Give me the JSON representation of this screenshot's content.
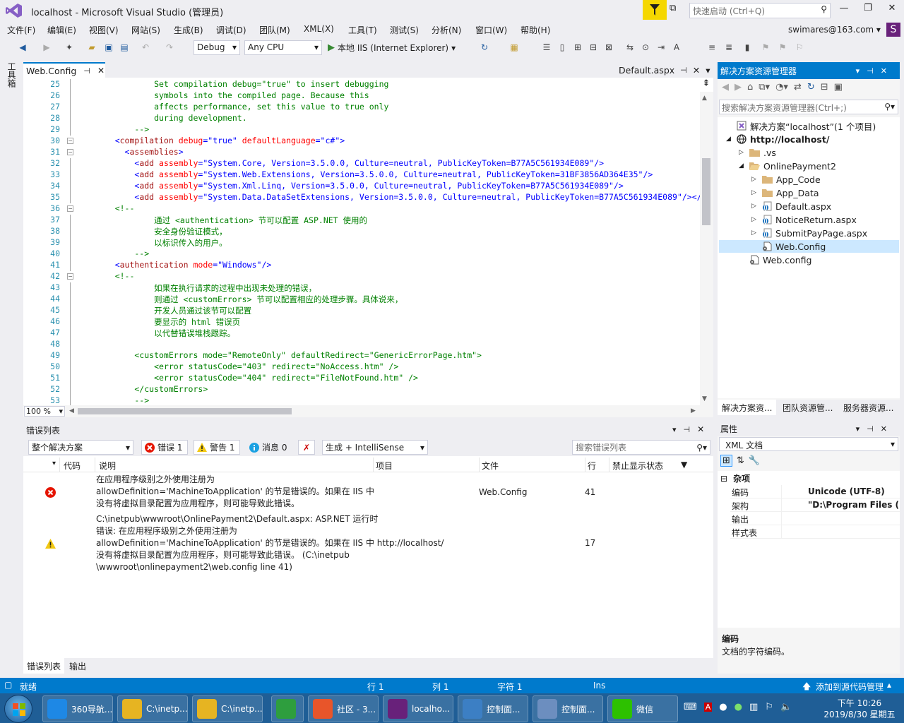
{
  "window": {
    "title": "localhost - Microsoft Visual Studio (管理员)",
    "quick_launch_placeholder": "快速启动 (Ctrl+Q)"
  },
  "menu": [
    "文件(F)",
    "编辑(E)",
    "视图(V)",
    "网站(S)",
    "生成(B)",
    "调试(D)",
    "团队(M)",
    "XML(X)",
    "工具(T)",
    "测试(S)",
    "分析(N)",
    "窗口(W)",
    "帮助(H)"
  ],
  "account": {
    "email": "swimares@163.com",
    "avatar_letter": "S"
  },
  "toolbar": {
    "config": "Debug",
    "platform": "Any CPU",
    "run_label": "本地 IIS (Internet Explorer)"
  },
  "toolbox": {
    "label": "工具箱"
  },
  "editor": {
    "active_tab": "Web.Config",
    "right_tab": "Default.aspx",
    "zoom": "100 %",
    "lines": [
      {
        "n": "25",
        "s": [
          {
            "c": "c",
            "t": "            Set compilation debug=\"true\" to insert debugging"
          }
        ]
      },
      {
        "n": "26",
        "s": [
          {
            "c": "c",
            "t": "            symbols into the compiled page. Because this"
          }
        ]
      },
      {
        "n": "27",
        "s": [
          {
            "c": "c",
            "t": "            affects performance, set this value to true only"
          }
        ]
      },
      {
        "n": "28",
        "s": [
          {
            "c": "c",
            "t": "            during development."
          }
        ]
      },
      {
        "n": "29",
        "s": [
          {
            "c": "c",
            "t": "        -->"
          }
        ]
      },
      {
        "n": "30",
        "fold": true,
        "s": [
          {
            "c": "b",
            "t": "    <"
          },
          {
            "c": "t",
            "t": "compilation"
          },
          {
            "c": "a",
            "t": " debug"
          },
          {
            "c": "b",
            "t": "=\""
          },
          {
            "c": "v",
            "t": "true"
          },
          {
            "c": "b",
            "t": "\""
          },
          {
            "c": "a",
            "t": " defaultLanguage"
          },
          {
            "c": "b",
            "t": "=\""
          },
          {
            "c": "v",
            "t": "c#"
          },
          {
            "c": "b",
            "t": "\">"
          }
        ]
      },
      {
        "n": "31",
        "fold": true,
        "s": [
          {
            "c": "b",
            "t": "      <"
          },
          {
            "c": "t",
            "t": "assemblies"
          },
          {
            "c": "b",
            "t": ">"
          }
        ]
      },
      {
        "n": "32",
        "s": [
          {
            "c": "b",
            "t": "        <"
          },
          {
            "c": "t",
            "t": "add"
          },
          {
            "c": "a",
            "t": " assembly"
          },
          {
            "c": "b",
            "t": "=\""
          },
          {
            "c": "v",
            "t": "System.Core, Version=3.5.0.0, Culture=neutral, PublicKeyToken=B77A5C561934E089"
          },
          {
            "c": "b",
            "t": "\"/>"
          }
        ]
      },
      {
        "n": "33",
        "s": [
          {
            "c": "b",
            "t": "        <"
          },
          {
            "c": "t",
            "t": "add"
          },
          {
            "c": "a",
            "t": " assembly"
          },
          {
            "c": "b",
            "t": "=\""
          },
          {
            "c": "v",
            "t": "System.Web.Extensions, Version=3.5.0.0, Culture=neutral, PublicKeyToken=31BF3856AD364E35"
          },
          {
            "c": "b",
            "t": "\"/>"
          }
        ]
      },
      {
        "n": "34",
        "s": [
          {
            "c": "b",
            "t": "        <"
          },
          {
            "c": "t",
            "t": "add"
          },
          {
            "c": "a",
            "t": " assembly"
          },
          {
            "c": "b",
            "t": "=\""
          },
          {
            "c": "v",
            "t": "System.Xml.Linq, Version=3.5.0.0, Culture=neutral, PublicKeyToken=B77A5C561934E089"
          },
          {
            "c": "b",
            "t": "\"/>"
          }
        ]
      },
      {
        "n": "35",
        "s": [
          {
            "c": "b",
            "t": "        <"
          },
          {
            "c": "t",
            "t": "add"
          },
          {
            "c": "a",
            "t": " assembly"
          },
          {
            "c": "b",
            "t": "=\""
          },
          {
            "c": "v",
            "t": "System.Data.DataSetExtensions, Version=3.5.0.0, Culture=neutral, PublicKeyToken=B77A5C561934E089"
          },
          {
            "c": "b",
            "t": "\"/></"
          },
          {
            "c": "t",
            "t": "as"
          }
        ]
      },
      {
        "n": "36",
        "fold": true,
        "s": [
          {
            "c": "c",
            "t": "    <!--"
          }
        ]
      },
      {
        "n": "37",
        "s": [
          {
            "c": "c",
            "t": "            通过 <authentication> 节可以配置 ASP.NET 使用的"
          }
        ]
      },
      {
        "n": "38",
        "s": [
          {
            "c": "c",
            "t": "            安全身份验证模式，"
          }
        ]
      },
      {
        "n": "39",
        "s": [
          {
            "c": "c",
            "t": "            以标识传入的用户。"
          }
        ]
      },
      {
        "n": "40",
        "s": [
          {
            "c": "c",
            "t": "        -->"
          }
        ]
      },
      {
        "n": "41",
        "s": [
          {
            "c": "b",
            "t": "    <"
          },
          {
            "c": "t",
            "t": "authentication"
          },
          {
            "c": "a",
            "t": " mode"
          },
          {
            "c": "b",
            "t": "=\""
          },
          {
            "c": "v",
            "t": "Windows"
          },
          {
            "c": "b",
            "t": "\"/>"
          }
        ]
      },
      {
        "n": "42",
        "fold": true,
        "s": [
          {
            "c": "c",
            "t": "    <!--"
          }
        ]
      },
      {
        "n": "43",
        "s": [
          {
            "c": "c",
            "t": "            如果在执行请求的过程中出现未处理的错误，"
          }
        ]
      },
      {
        "n": "44",
        "s": [
          {
            "c": "c",
            "t": "            则通过 <customErrors> 节可以配置相应的处理步骤。具体说来，"
          }
        ]
      },
      {
        "n": "45",
        "s": [
          {
            "c": "c",
            "t": "            开发人员通过该节可以配置"
          }
        ]
      },
      {
        "n": "46",
        "s": [
          {
            "c": "c",
            "t": "            要显示的 html 错误页"
          }
        ]
      },
      {
        "n": "47",
        "s": [
          {
            "c": "c",
            "t": "            以代替错误堆栈跟踪。"
          }
        ]
      },
      {
        "n": "48",
        "s": [
          {
            "c": "c",
            "t": ""
          }
        ]
      },
      {
        "n": "49",
        "s": [
          {
            "c": "c",
            "t": "        <customErrors mode=\"RemoteOnly\" defaultRedirect=\"GenericErrorPage.htm\">"
          }
        ]
      },
      {
        "n": "50",
        "s": [
          {
            "c": "c",
            "t": "            <error statusCode=\"403\" redirect=\"NoAccess.htm\" />"
          }
        ]
      },
      {
        "n": "51",
        "s": [
          {
            "c": "c",
            "t": "            <error statusCode=\"404\" redirect=\"FileNotFound.htm\" />"
          }
        ]
      },
      {
        "n": "52",
        "s": [
          {
            "c": "c",
            "t": "        </customErrors>"
          }
        ]
      },
      {
        "n": "53",
        "s": [
          {
            "c": "c",
            "t": "        -->"
          }
        ]
      }
    ]
  },
  "error_list": {
    "title": "错误列表",
    "scope": "整个解决方案",
    "errors_label": "错误 1",
    "warnings_label": "警告 1",
    "messages_label": "消息 0",
    "build_filter": "生成 + IntelliSense",
    "search_placeholder": "搜索错误列表",
    "columns": {
      "code": "代码",
      "desc": "说明",
      "project": "项目",
      "file": "文件",
      "line": "行",
      "suppress": "禁止显示状态"
    },
    "rows": [
      {
        "type": "error",
        "desc": [
          "在应用程序级别之外使用注册为",
          "allowDefinition='MachineToApplication' 的节是错误的。如果在 IIS 中",
          "没有将虚拟目录配置为应用程序，则可能导致此错误。"
        ],
        "project": "",
        "file": "Web.Config",
        "line": "41"
      },
      {
        "type": "warning",
        "desc": [
          "C:\\inetpub\\wwwroot\\OnlinePayment2\\Default.aspx: ASP.NET 运行时",
          "错误: 在应用程序级别之外使用注册为",
          "allowDefinition='MachineToApplication' 的节是错误的。如果在 IIS 中 http://localhost/",
          "没有将虚拟目录配置为应用程序，则可能导致此错误。 (C:\\inetpub",
          "\\wwwroot\\onlinepayment2\\web.config line 41)"
        ],
        "project": "",
        "file": "",
        "line": "17"
      }
    ],
    "bottom_tabs": [
      "错误列表",
      "输出"
    ]
  },
  "solution_explorer": {
    "title": "解决方案资源管理器",
    "search_placeholder": "搜索解决方案资源管理器(Ctrl+;)",
    "tree": [
      {
        "label": "解决方案“localhost”(1 个项目)",
        "depth": 0,
        "icon": "solution",
        "arrow": ""
      },
      {
        "label": "http://localhost/",
        "depth": 0,
        "icon": "globe",
        "arrow": "◢",
        "bold": true
      },
      {
        "label": ".vs",
        "depth": 1,
        "icon": "folder",
        "arrow": "▷"
      },
      {
        "label": "OnlinePayment2",
        "depth": 1,
        "icon": "folder-open",
        "arrow": "◢"
      },
      {
        "label": "App_Code",
        "depth": 2,
        "icon": "folder",
        "arrow": "▷"
      },
      {
        "label": "App_Data",
        "depth": 2,
        "icon": "folder",
        "arrow": "▷"
      },
      {
        "label": "Default.aspx",
        "depth": 2,
        "icon": "aspx",
        "arrow": "▷"
      },
      {
        "label": "NoticeReturn.aspx",
        "depth": 2,
        "icon": "aspx",
        "arrow": "▷"
      },
      {
        "label": "SubmitPayPage.aspx",
        "depth": 2,
        "icon": "aspx",
        "arrow": "▷"
      },
      {
        "label": "Web.Config",
        "depth": 2,
        "icon": "config",
        "arrow": "",
        "selected": true
      },
      {
        "label": "Web.config",
        "depth": 1,
        "icon": "config",
        "arrow": ""
      }
    ],
    "tabs": [
      "解决方案资...",
      "团队资源管...",
      "服务器资源..."
    ]
  },
  "properties": {
    "title": "属性",
    "object": "XML 文档",
    "category": "杂项",
    "rows": [
      {
        "name": "编码",
        "value": "Unicode (UTF-8)"
      },
      {
        "name": "架构",
        "value": "\"D:\\Program Files (x"
      },
      {
        "name": "输出",
        "value": ""
      },
      {
        "name": "样式表",
        "value": ""
      }
    ],
    "desc_title": "编码",
    "desc_text": "文档的字符编码。"
  },
  "status": {
    "ready": "就绪",
    "row": "行 1",
    "col": "列 1",
    "char": "字符 1",
    "mode": "Ins",
    "source": "添加到源代码管理"
  },
  "taskbar": {
    "items": [
      {
        "label": "360导航...",
        "color": "#1E88E5"
      },
      {
        "label": "C:\\inetp...",
        "color": "#E6B422"
      },
      {
        "label": "C:\\inetp...",
        "color": "#E6B422"
      },
      {
        "label": "",
        "color": "#2E9E3E"
      },
      {
        "label": "社区 - 3...",
        "color": "#E8552A"
      },
      {
        "label": "localho...",
        "color": "#68217A"
      },
      {
        "label": "控制面...",
        "color": "#3C7FC4"
      },
      {
        "label": "控制面...",
        "color": "#6C8EBF"
      },
      {
        "label": "微信",
        "color": "#2DC100"
      }
    ],
    "time": "下午 10:26",
    "date": "2019/8/30 星期五"
  }
}
